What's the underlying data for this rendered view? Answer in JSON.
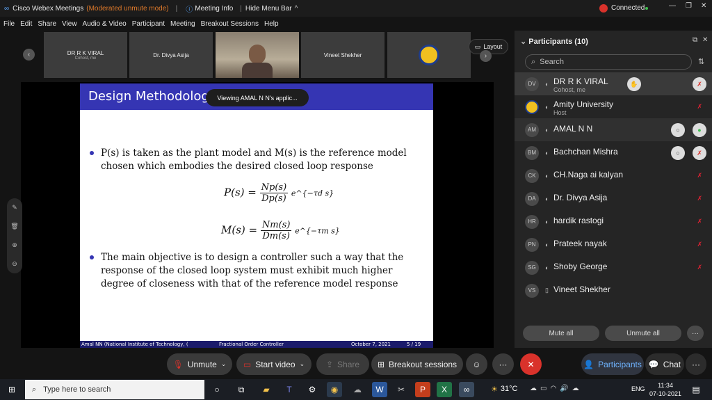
{
  "titlebar": {
    "app": "Cisco Webex Meetings",
    "mode": "(Moderated unmute mode)",
    "meeting_info": "Meeting Info",
    "hide_menu": "Hide Menu Bar",
    "connected": "Connected",
    "chevron": "^"
  },
  "menu": [
    "File",
    "Edit",
    "Share",
    "View",
    "Audio & Video",
    "Participant",
    "Meeting",
    "Breakout Sessions",
    "Help"
  ],
  "thumbs": [
    {
      "name": "DR R K VIRAL",
      "role": "Cohost, me"
    },
    {
      "name": "Dr. Divya Asija",
      "role": ""
    },
    {
      "name": "",
      "role": ""
    },
    {
      "name": "Vineet Shekher",
      "role": ""
    },
    {
      "name": "",
      "role": ""
    }
  ],
  "layout_btn": "Layout",
  "viewing_badge": "Viewing AMAL N N's applic...",
  "slide": {
    "title": "Design Methodology",
    "bullet1": "P(s) is taken as the plant model and M(s) is the reference model chosen which embodies the desired closed loop response",
    "eq1_lhs": "P(s) =",
    "eq1_num": "Np(s)",
    "eq1_den": "Dp(s)",
    "eq1_exp": "e^{−τd s}",
    "eq2_lhs": "M(s) =",
    "eq2_num": "Nm(s)",
    "eq2_den": "Dm(s)",
    "eq2_exp": "e^{−τm s}",
    "bullet2": "The main objective is to design a controller such a way that the response of the closed loop system must exhibit much higher degree of closeness with that of the reference model response",
    "footer_author": "Amal NN (National Institute of Technology, (",
    "footer_title": "Fractional Order Controller",
    "footer_date": "October 7, 2021",
    "footer_page": "5 / 19"
  },
  "controls": {
    "unmute": "Unmute",
    "start_video": "Start video",
    "share": "Share",
    "breakout": "Breakout sessions",
    "participants": "Participants",
    "chat": "Chat",
    "more": "···"
  },
  "panel": {
    "title": "Participants (10)",
    "search_placeholder": "Search",
    "mute_all": "Mute all",
    "unmute_all": "Unmute all",
    "participants": [
      {
        "initials": "DV",
        "name": "DR R K VIRAL",
        "role": "Cohost, me"
      },
      {
        "initials": "",
        "name": "Amity University",
        "role": "Host"
      },
      {
        "initials": "AM",
        "name": "AMAL N N",
        "role": ""
      },
      {
        "initials": "BM",
        "name": "Bachchan Mishra",
        "role": ""
      },
      {
        "initials": "CK",
        "name": "CH.Naga ai kalyan",
        "role": ""
      },
      {
        "initials": "DA",
        "name": "Dr. Divya Asija",
        "role": ""
      },
      {
        "initials": "HR",
        "name": "hardik rastogi",
        "role": ""
      },
      {
        "initials": "PN",
        "name": "Prateek nayak",
        "role": ""
      },
      {
        "initials": "SG",
        "name": "Shoby George",
        "role": ""
      },
      {
        "initials": "VS",
        "name": "Vineet Shekher",
        "role": ""
      }
    ]
  },
  "taskbar": {
    "search_placeholder": "Type here to search",
    "weather": "31°C",
    "lang": "ENG",
    "time": "11:34",
    "date": "07-10-2021"
  },
  "colors": {
    "accent": "#3535b3",
    "danger": "#d9322b",
    "green": "#3fbf4f"
  }
}
